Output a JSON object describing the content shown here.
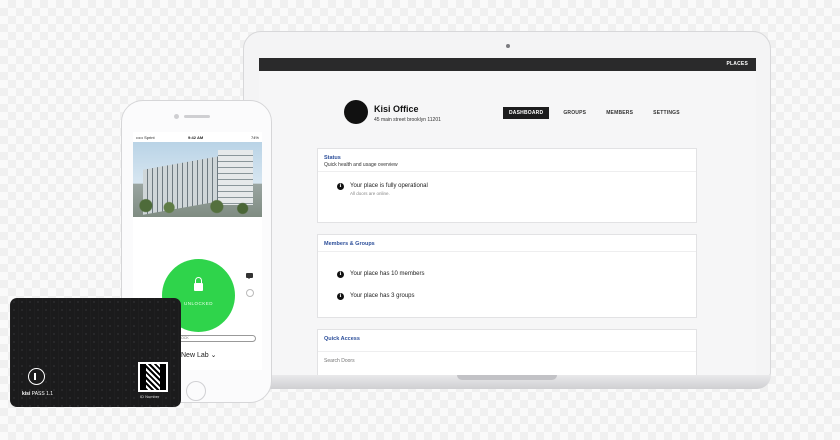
{
  "dashboard": {
    "topbar": {
      "places": "PLACES"
    },
    "place": {
      "name": "Kisi Office",
      "address": "45 main street brooklyn 11201"
    },
    "nav": [
      {
        "label": "DASHBOARD",
        "active": true
      },
      {
        "label": "GROUPS",
        "active": false
      },
      {
        "label": "MEMBERS",
        "active": false
      },
      {
        "label": "SETTINGS",
        "active": false
      }
    ],
    "status": {
      "title": "Status",
      "subtitle": "Quick health and usage overview",
      "message": "Your place is fully operational",
      "detail": "All doors are online."
    },
    "members_groups": {
      "title": "Members & Groups",
      "members_text": "Your place has 10 members",
      "groups_text": "Your place has 3 groups"
    },
    "quick_access": {
      "title": "Quick Access",
      "search_placeholder": "Search Doors"
    }
  },
  "phone": {
    "status": {
      "carrier": "••••• Sprint",
      "time": "9:42 AM",
      "battery": "74%"
    },
    "unlock_label": "UNLOCKED",
    "tap_hint": "TAP TO UNLOCK",
    "lab": "New Lab"
  },
  "card": {
    "brand": "kisi",
    "model": "PASS 1.1",
    "qr_label": "ID Number"
  },
  "colors": {
    "accent_green": "#2fd44b",
    "nav_active": "#1c1c1d",
    "card_title": "#2d4f9a"
  },
  "icons": [
    "info-icon",
    "lock-icon",
    "chat-icon",
    "chevron-down-icon",
    "qr-code",
    "kisi-logo"
  ]
}
